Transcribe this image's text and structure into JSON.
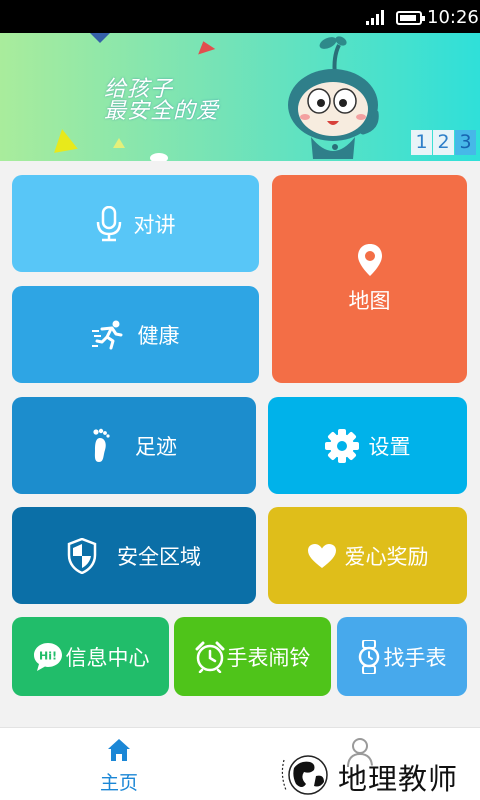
{
  "status_bar": {
    "time": "10:26"
  },
  "banner": {
    "slogan_line1": "给孩子",
    "slogan_line2": "最安全的爱",
    "pages": [
      "1",
      "2",
      "3"
    ],
    "active_page": 3
  },
  "tiles": {
    "intercom": {
      "label": "对讲",
      "icon": "microphone-icon",
      "color": "#58c6f7"
    },
    "map": {
      "label": "地图",
      "icon": "location-pin-icon",
      "color": "#f36e46"
    },
    "health": {
      "label": "健康",
      "icon": "running-man-icon",
      "color": "#2ea5e4"
    },
    "footprint": {
      "label": "足迹",
      "icon": "footprint-icon",
      "color": "#1c8dcd"
    },
    "settings": {
      "label": "设置",
      "icon": "gear-icon",
      "color": "#00b2ea"
    },
    "safezone": {
      "label": "安全区域",
      "icon": "shield-icon",
      "color": "#0b6fa7"
    },
    "reward": {
      "label": "爱心奖励",
      "icon": "heart-icon",
      "color": "#dfbe1a"
    },
    "info": {
      "label": "信息中心",
      "icon": "hi-chat-bubble-icon",
      "color": "#21bd6a"
    },
    "alarm": {
      "label": "手表闹铃",
      "icon": "alarm-clock-icon",
      "color": "#4fc41a"
    },
    "find": {
      "label": "找手表",
      "icon": "watch-icon",
      "color": "#47a9ec"
    }
  },
  "bottom_nav": {
    "home": {
      "label": "主页",
      "icon": "home-icon",
      "active": true
    },
    "mine": {
      "icon": "person-icon"
    }
  },
  "watermark": {
    "text": "地理教师"
  }
}
